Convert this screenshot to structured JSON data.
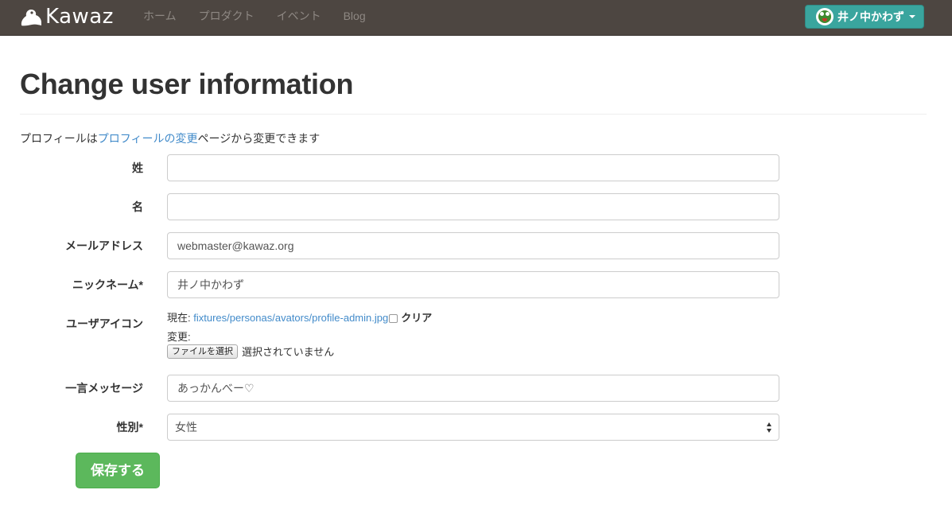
{
  "navbar": {
    "brand": "Kawaz",
    "links": [
      "ホーム",
      "プロダクト",
      "イベント",
      "Blog"
    ],
    "user_name": "井ノ中かわず"
  },
  "page": {
    "title": "Change user information",
    "intro_prefix": "プロフィールは",
    "intro_link": "プロフィールの変更",
    "intro_suffix": "ページから変更できます"
  },
  "form": {
    "last_name": {
      "label": "姓",
      "value": ""
    },
    "first_name": {
      "label": "名",
      "value": ""
    },
    "email": {
      "label": "メールアドレス",
      "value": "webmaster@kawaz.org"
    },
    "nickname": {
      "label": "ニックネーム*",
      "value": "井ノ中かわず"
    },
    "avatar": {
      "label": "ユーザアイコン",
      "current_prefix": "現在:",
      "current_link": "fixtures/personas/avators/profile-admin.jpg",
      "clear_label": "クリア",
      "change_label": "変更:",
      "file_button": "ファイルを選択",
      "file_status": "選択されていません"
    },
    "quote": {
      "label": "一言メッセージ",
      "value": "あっかんべー♡"
    },
    "gender": {
      "label": "性別*",
      "value": "女性"
    },
    "submit_label": "保存する"
  },
  "colors": {
    "navbar_bg": "#4d4641",
    "user_button": "#3aa59e",
    "link": "#428bca",
    "save_button": "#5cb85c"
  }
}
